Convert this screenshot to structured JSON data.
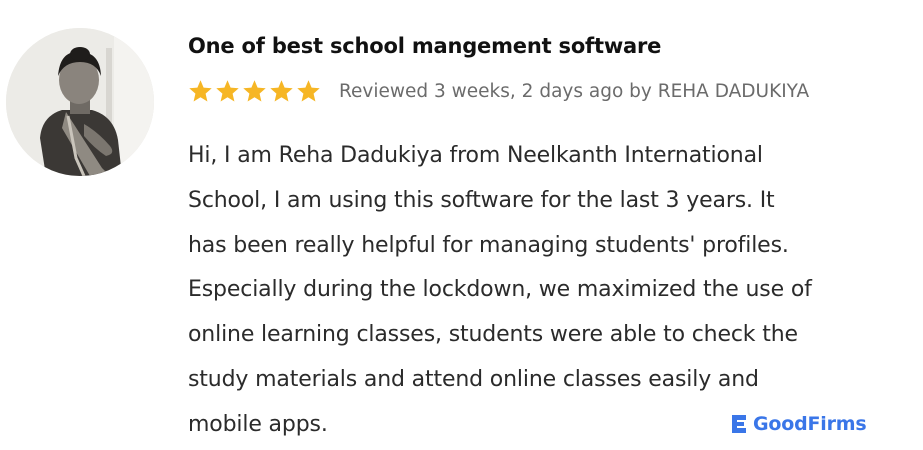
{
  "review": {
    "title": "One of best school mangement software",
    "rating": 5,
    "max_rating": 5,
    "star_color": "#f6b625",
    "meta": "Reviewed 3 weeks, 2 days ago by REHA DADUKIYA",
    "body_lines": [
      "Hi, I am Reha Dadukiya from Neelkanth International",
      "School, I am using this software for the last 3 years. It",
      "has been really helpful for managing students' profiles.",
      "Especially during the lockdown, we maximized the use of",
      "online learning classes, students were able to check the",
      "study materials and attend online classes easily and",
      "mobile apps."
    ]
  },
  "reviewer": {
    "avatar_icon": "reviewer-photo"
  },
  "brand": {
    "name": "GoodFirms",
    "color": "#3a76e8",
    "icon": "goodfirms-logo-icon"
  }
}
